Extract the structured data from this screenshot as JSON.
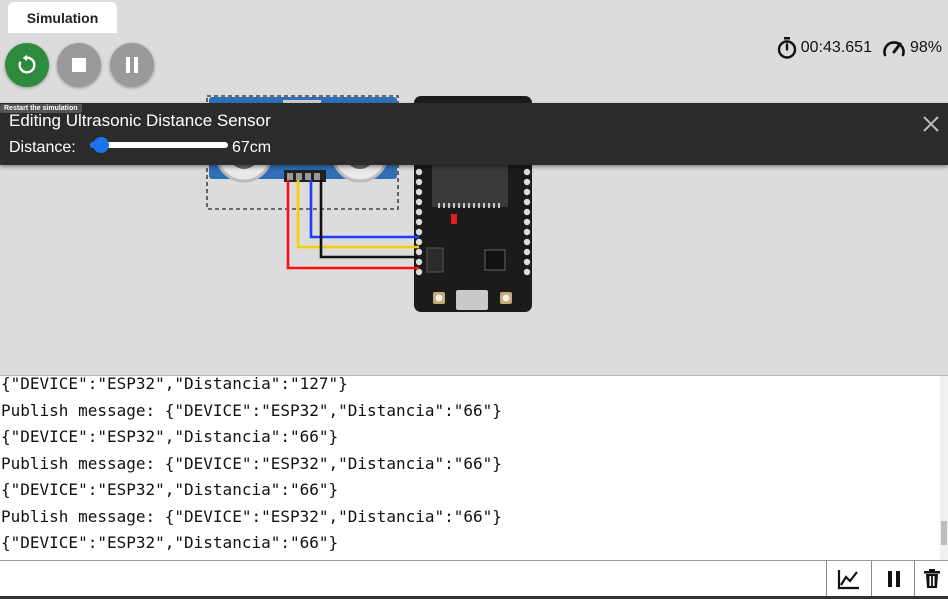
{
  "tabs": [
    {
      "label": "Simulation"
    }
  ],
  "controls": {
    "restart_tooltip": "Restart the simulation",
    "timer": "00:43.651",
    "speed": "98%"
  },
  "editor": {
    "title": "Editing Ultrasonic Distance Sensor",
    "distance_label": "Distance:",
    "distance_value": "67cm",
    "slider_fraction": 0.08
  },
  "console": {
    "lines": [
      "{\"DEVICE\":\"ESP32\",\"Distancia\":\"127\"}",
      "Publish message: {\"DEVICE\":\"ESP32\",\"Distancia\":\"66\"}",
      "{\"DEVICE\":\"ESP32\",\"Distancia\":\"66\"}",
      "Publish message: {\"DEVICE\":\"ESP32\",\"Distancia\":\"66\"}",
      "{\"DEVICE\":\"ESP32\",\"Distancia\":\"66\"}",
      "Publish message: {\"DEVICE\":\"ESP32\",\"Distancia\":\"66\"}",
      "{\"DEVICE\":\"ESP32\",\"Distancia\":\"66\"}"
    ],
    "input_value": ""
  },
  "colors": {
    "restart": "#2e8b3e",
    "accent": "#1a73e8",
    "wire_blue": "#1a3dff",
    "wire_yellow": "#f5d000",
    "wire_black": "#111111",
    "wire_red": "#ff1010"
  },
  "icons": {
    "restart": "restart-icon",
    "stop": "stop-icon",
    "pause": "pause-icon",
    "timer": "stopwatch-icon",
    "speed": "speedometer-icon",
    "close": "close-icon",
    "chart": "chart-icon",
    "console_pause": "pause-icon",
    "delete": "trash-icon"
  }
}
